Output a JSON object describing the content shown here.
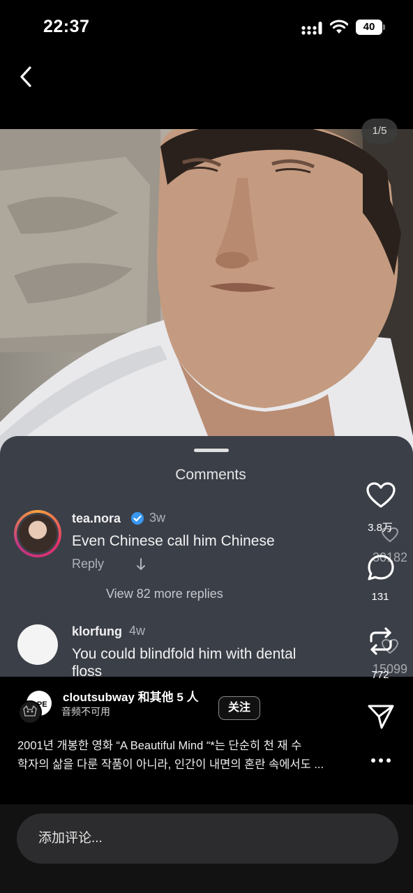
{
  "status_bar": {
    "time": "22:37",
    "battery": "40"
  },
  "post": {
    "page_indicator": "1/5",
    "embedded_comments": {
      "title": "Comments",
      "comments": [
        {
          "user": "tea.nora",
          "verified": true,
          "time": "3w",
          "text": "Even Chinese call him Chinese",
          "reply_label": "Reply",
          "view_more": "View 82 more replies"
        },
        {
          "user": "klorfung",
          "time": "4w",
          "text": "You could blindfold him with dental",
          "text_line2": "floss"
        }
      ],
      "ghost_counts": [
        "30182",
        "15099"
      ]
    },
    "actions": {
      "like_count": "3.8万",
      "comment_count": "131",
      "repost_count": "772"
    },
    "author": {
      "name": "cloutsubway 和其他 5 人",
      "audio_note": "音频不可用",
      "follow_label": "关注",
      "avatar_text": "OPE"
    },
    "caption_line1": "2001년 개봉한 영화 “A Beautiful Mind “*는 단순히 천 재 수",
    "caption_line2": "학자의 삶을 다룬 작품이 아니라, 인간이 내면의 혼란 속에서도 ..."
  },
  "comment_input": {
    "placeholder": "添加评论..."
  },
  "colors": {
    "background": "#000000",
    "panel": "#3b3f48",
    "verified": "#3897f0",
    "input_bg": "#2c2c2e"
  }
}
